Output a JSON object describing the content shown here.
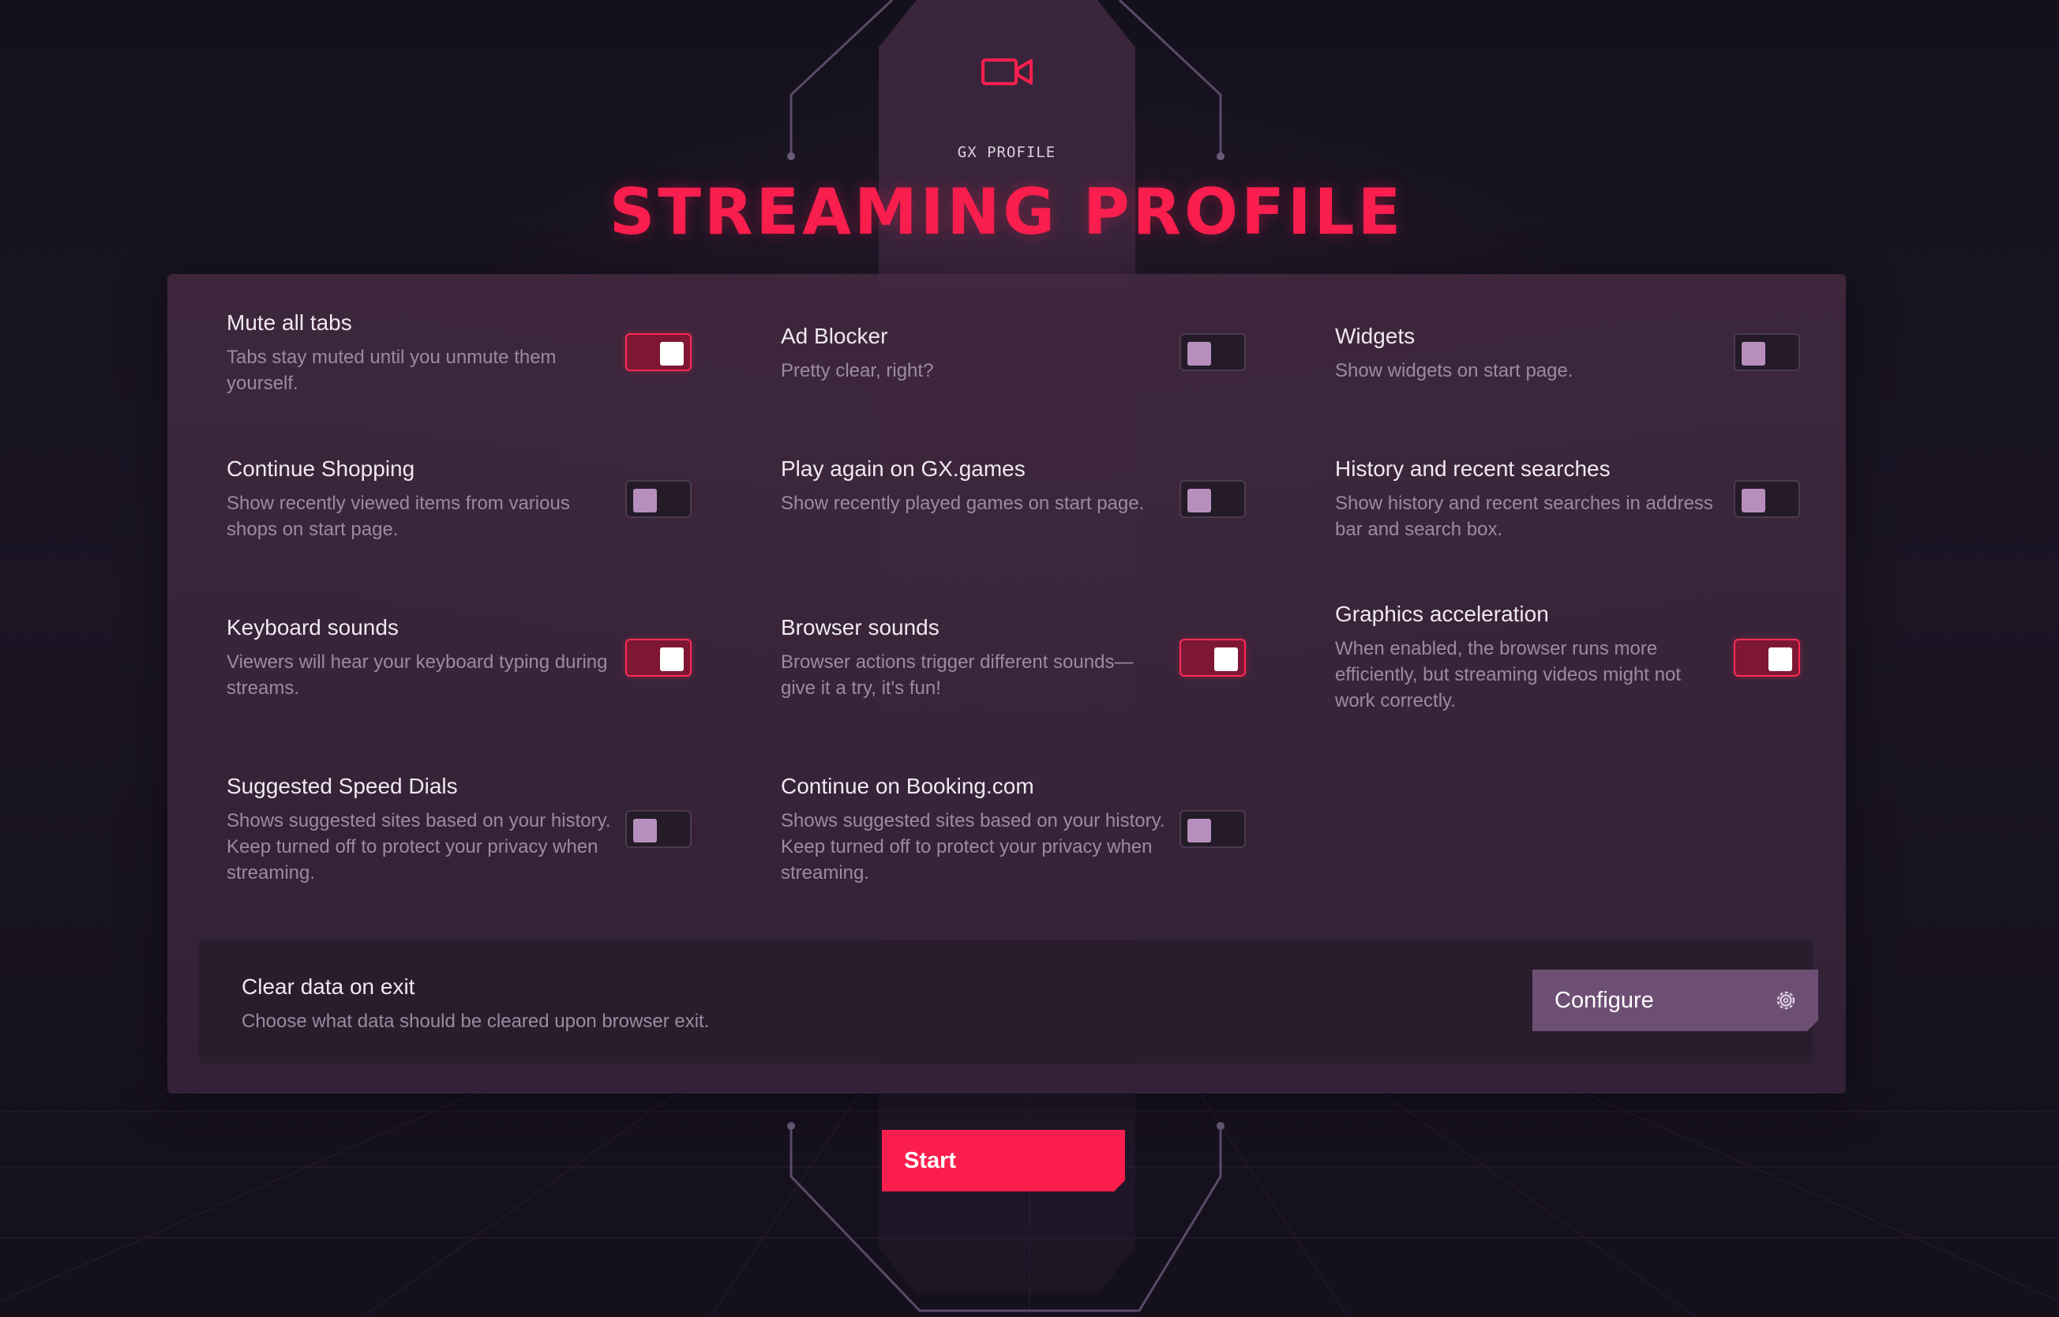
{
  "header": {
    "profile_label": "GX PROFILE",
    "title": "STREAMING PROFILE",
    "icon": "video-camera-icon"
  },
  "colors": {
    "accent": "#fa1e4e",
    "toggle_on": "#ff2a55",
    "toggle_off_knob": "#b78fbd",
    "panel": "#3e283e",
    "configure_button": "#6e4f74"
  },
  "settings": [
    {
      "title": "Mute all tabs",
      "description": "Tabs stay muted until you unmute them yourself.",
      "enabled": true
    },
    {
      "title": "Ad Blocker",
      "description": "Pretty clear, right?",
      "enabled": false
    },
    {
      "title": "Widgets",
      "description": "Show widgets on start page.",
      "enabled": false
    },
    {
      "title": "Continue Shopping",
      "description": "Show recently viewed items from various shops on start page.",
      "enabled": false
    },
    {
      "title": "Play again on GX.games",
      "description": "Show recently played games on start page.",
      "enabled": false
    },
    {
      "title": "History and recent searches",
      "description": "Show history and recent searches in address bar and search box.",
      "enabled": false
    },
    {
      "title": "Keyboard sounds",
      "description": "Viewers will hear your keyboard typing during streams.",
      "enabled": true
    },
    {
      "title": "Browser sounds",
      "description": "Browser actions trigger different sounds—give it a try, it's fun!",
      "enabled": true
    },
    {
      "title": "Graphics acceleration",
      "description": "When enabled, the browser runs more efficiently, but streaming videos might not work correctly.",
      "enabled": true
    },
    {
      "title": "Suggested Speed Dials",
      "description": "Shows suggested sites based on your history. Keep turned off to protect your privacy when streaming.",
      "enabled": false
    },
    {
      "title": "Continue on Booking.com",
      "description": "Shows suggested sites based on your history. Keep turned off to protect your privacy when streaming.",
      "enabled": false
    }
  ],
  "clear_data": {
    "title": "Clear data on exit",
    "description": "Choose what data should be cleared upon browser exit.",
    "button_label": "Configure",
    "button_icon": "gear-icon"
  },
  "start_button_label": "Start"
}
